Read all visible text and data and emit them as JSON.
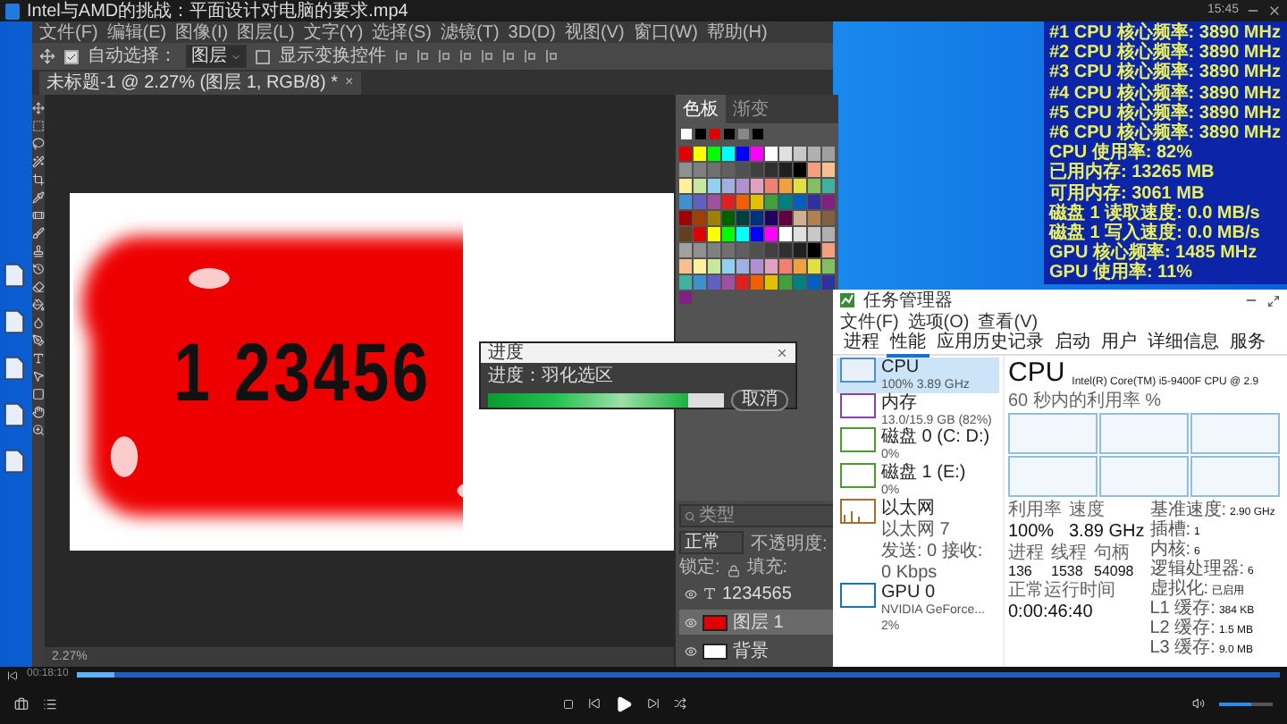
{
  "player": {
    "title": "Intel与AMD的挑战：平面设计对电脑的要求.mp4",
    "clock": "15:45",
    "time": "00:18:10",
    "progress": {
      "level": 0.03
    },
    "volume": {
      "level": 0.6
    }
  },
  "photoshop": {
    "menu": [
      "文件(F)",
      "编辑(E)",
      "图像(I)",
      "图层(L)",
      "文字(Y)",
      "选择(S)",
      "滤镜(T)",
      "3D(D)",
      "视图(V)",
      "窗口(W)",
      "帮助(H)"
    ],
    "options": {
      "auto_select_label": "自动选择：",
      "auto_select_checked": true,
      "auto_select_value": "图层",
      "show_transform_label": "显示变换控件",
      "show_transform_checked": false
    },
    "tab": {
      "title": "未标题-1 @ 2.27% (图层 1, RGB/8) *",
      "close": "×"
    },
    "canvas_text": "1 23456",
    "zoom": "2.27%",
    "swatch_tabs": [
      {
        "label": "色板",
        "selected": true
      },
      {
        "label": "渐变",
        "selected": false
      }
    ],
    "layers": {
      "search_placeholder": "类型",
      "blend_mode": "正常",
      "opacity_label": "不透明度:",
      "lock_label": "锁定:",
      "fill_label": "填充:",
      "items": [
        {
          "name": "1234565",
          "kind": "text",
          "selected": false,
          "visible": true
        },
        {
          "name": "图层 1",
          "kind": "raster",
          "selected": true,
          "visible": true
        },
        {
          "name": "背景",
          "kind": "background",
          "selected": false,
          "visible": true
        }
      ]
    }
  },
  "progress_dialog": {
    "title": "进度",
    "message": "进度：羽化选区",
    "level": 0.85,
    "cancel": "取消"
  },
  "osd": [
    "#1 CPU 核心频率: 3890 MHz",
    "#2 CPU 核心频率: 3890 MHz",
    "#3 CPU 核心频率: 3890 MHz",
    "#4 CPU 核心频率: 3890 MHz",
    "#5 CPU 核心频率: 3890 MHz",
    "#6 CPU 核心频率: 3890 MHz",
    "CPU 使用率: 82%",
    "已用内存: 13265 MB",
    "可用内存: 3061 MB",
    "磁盘 1 读取速度: 0.0 MB/s",
    "磁盘 1 写入速度: 0.0 MB/s",
    "GPU 核心频率: 1485 MHz",
    "GPU 使用率: 11%"
  ],
  "task_manager": {
    "title": "任务管理器",
    "menu": [
      "文件(F)",
      "选项(O)",
      "查看(V)"
    ],
    "tabs": [
      {
        "label": "进程",
        "selected": false
      },
      {
        "label": "性能",
        "selected": true
      },
      {
        "label": "应用历史记录",
        "selected": false
      },
      {
        "label": "启动",
        "selected": false
      },
      {
        "label": "用户",
        "selected": false
      },
      {
        "label": "详细信息",
        "selected": false
      },
      {
        "label": "服务",
        "selected": false
      }
    ],
    "devices": [
      {
        "name": "CPU",
        "details": [
          "100% 3.89 GHz"
        ],
        "kind": "cpu",
        "selected": true
      },
      {
        "name": "内存",
        "details": [
          "13.0/15.9 GB (82%)"
        ],
        "kind": "memory",
        "selected": false
      },
      {
        "name": "磁盘 0 (C: D:)",
        "details": [
          "0%"
        ],
        "kind": "disk",
        "selected": false
      },
      {
        "name": "磁盘 1 (E:)",
        "details": [
          "0%"
        ],
        "kind": "disk",
        "selected": false
      },
      {
        "name": "以太网",
        "details": [
          "以太网 7",
          "发送: 0 接收: 0 Kbps"
        ],
        "kind": "network",
        "selected": false
      },
      {
        "name": "GPU 0",
        "details": [
          "NVIDIA GeForce...",
          "2%"
        ],
        "kind": "gpu",
        "selected": false
      }
    ],
    "heading": "CPU",
    "model": "Intel(R) Core(TM) i5-9400F CPU @ 2.9",
    "graph_label": "60 秒内的利用率 %",
    "stats": [
      {
        "label": "利用率",
        "value": "100%"
      },
      {
        "label": "速度",
        "value": "3.89 GHz"
      }
    ],
    "counts": [
      {
        "label": "进程",
        "value": "136"
      },
      {
        "label": "线程",
        "value": "1538"
      },
      {
        "label": "句柄",
        "value": "54098"
      }
    ],
    "uptime": {
      "label": "正常运行时间",
      "value": "0:00:46:40"
    },
    "specs": [
      {
        "label": "基准速度:",
        "value": "2.90 GHz"
      },
      {
        "label": "插槽:",
        "value": "1"
      },
      {
        "label": "内核:",
        "value": "6"
      },
      {
        "label": "逻辑处理器:",
        "value": "6"
      },
      {
        "label": "虚拟化:",
        "value": "已启用"
      },
      {
        "label": "L1 缓存:",
        "value": "384 KB"
      },
      {
        "label": "L2 缓存:",
        "value": "1.5 MB"
      },
      {
        "label": "L3 缓存:",
        "value": "9.0 MB"
      }
    ]
  }
}
